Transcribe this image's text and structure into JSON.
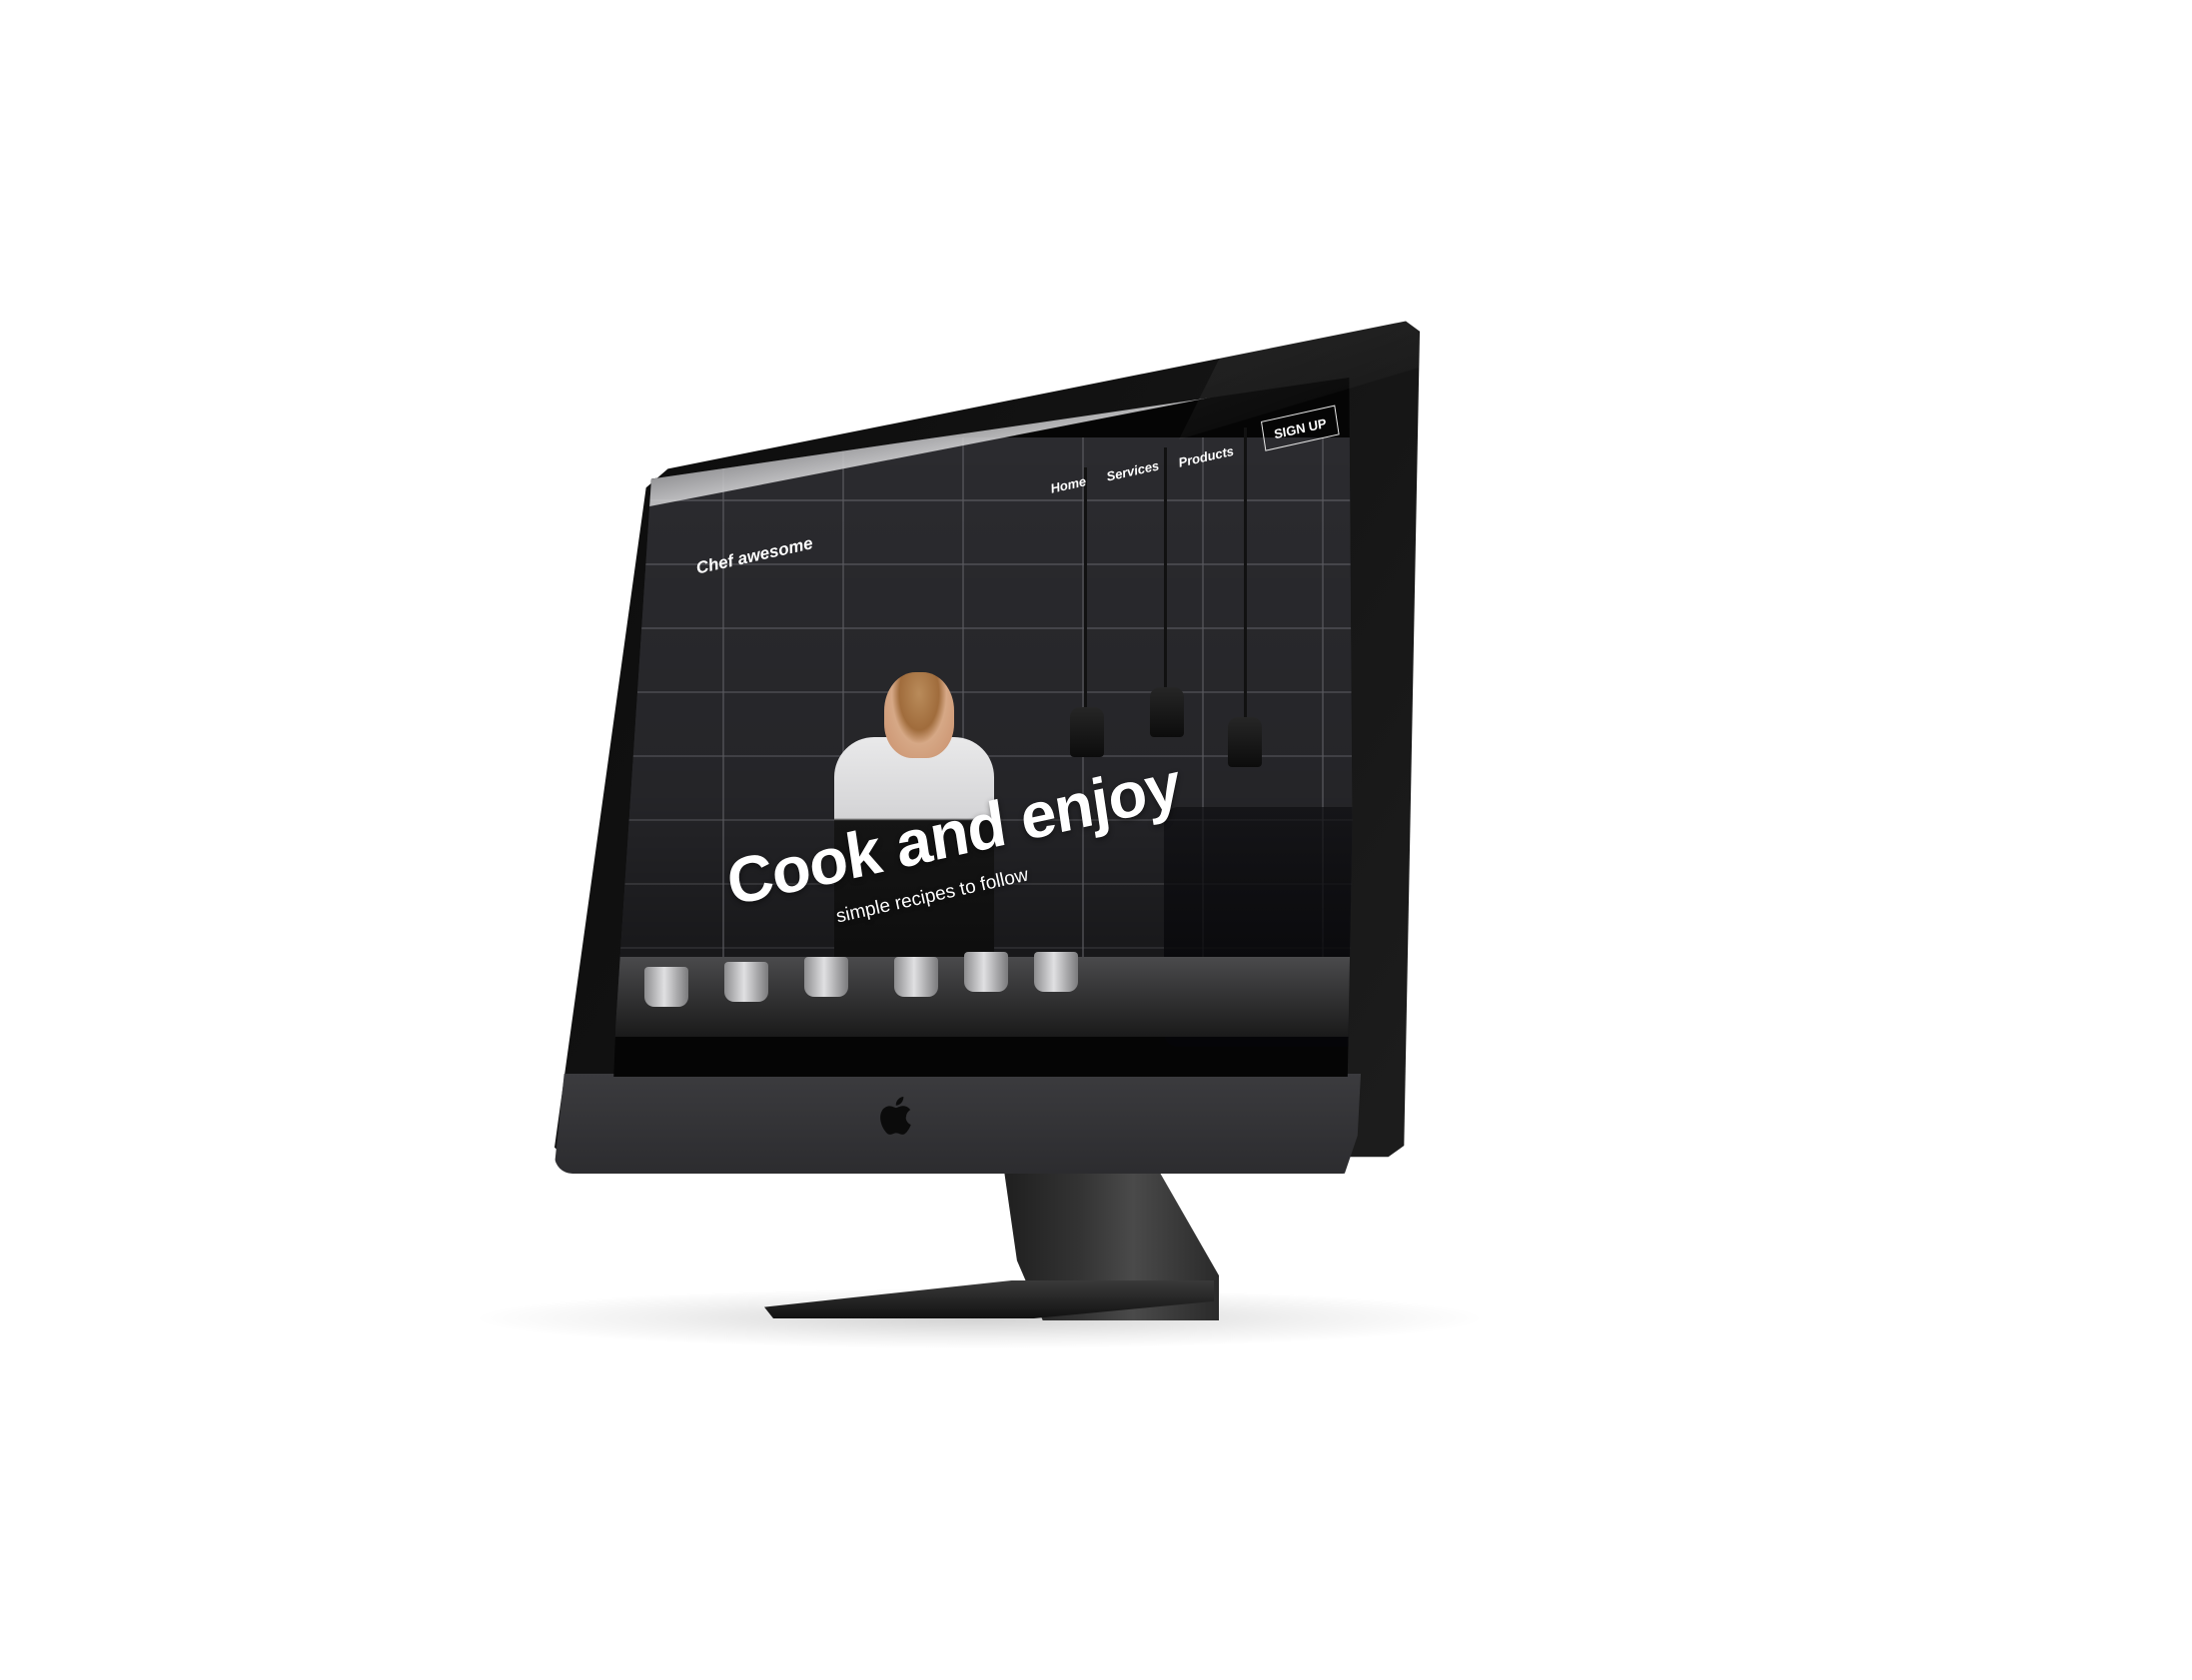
{
  "site": {
    "brand": "Chef awesome",
    "nav": [
      {
        "label": "Home"
      },
      {
        "label": "Services"
      },
      {
        "label": "Products"
      }
    ],
    "signup_label": "SIGN UP"
  },
  "hero": {
    "title": "Cook and enjoy",
    "subtitle": "simple recipes to follow"
  },
  "device": {
    "logo_icon": "apple-logo-icon"
  },
  "colors": {
    "nav_text": "#ffffff",
    "bezel": "#0c0c0c",
    "chin": "#2e2e31",
    "page_bg": "#ffffff"
  }
}
